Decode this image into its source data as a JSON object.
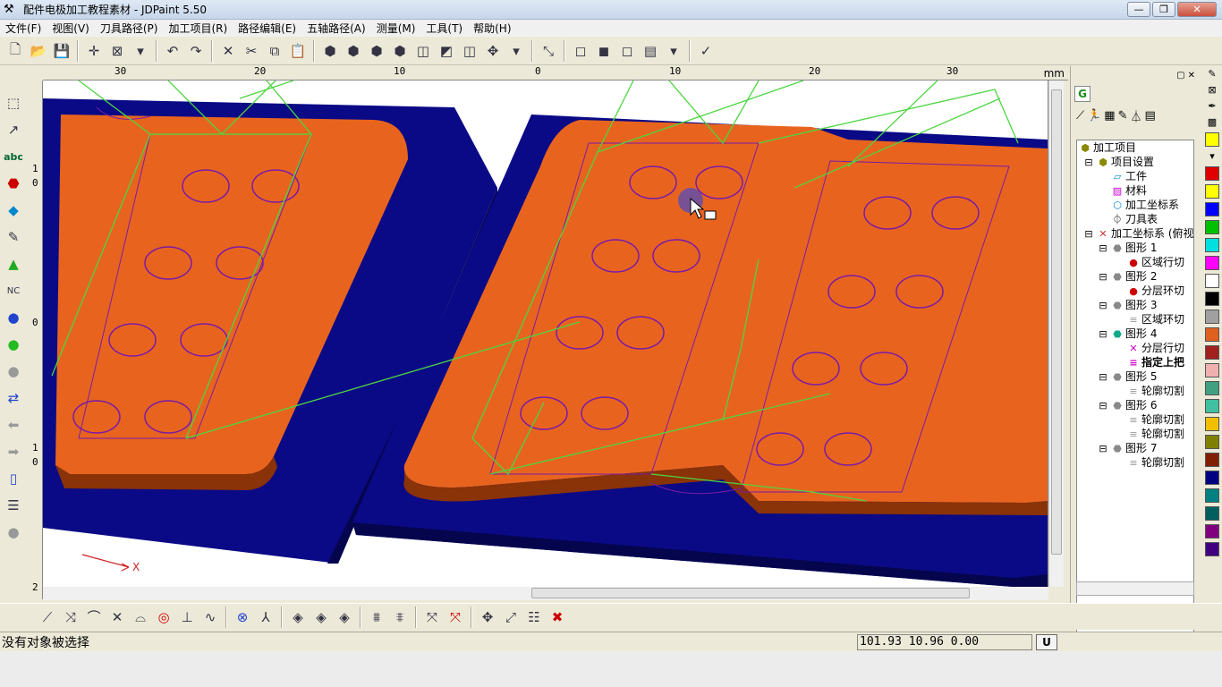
{
  "window": {
    "title": "配件电极加工教程素材 - JDPaint 5.50"
  },
  "menu": [
    "文件(F)",
    "视图(V)",
    "刀具路径(P)",
    "加工项目(R)",
    "路径编辑(E)",
    "五轴路径(A)",
    "测量(M)",
    "工具(T)",
    "帮助(H)"
  ],
  "ruler": {
    "ticks": [
      "30",
      "20",
      "10",
      "0",
      "10",
      "20",
      "30"
    ],
    "unit": "mm"
  },
  "vruler": {
    "ticks": [
      "1",
      "0",
      "0",
      "1",
      "0",
      "2"
    ]
  },
  "axis_label": "X",
  "tree": {
    "root": "加工项目",
    "settings": "项目设置",
    "workpiece": "工件",
    "material": "材料",
    "coord": "加工坐标系",
    "toollist": "刀具表",
    "coord2": "加工坐标系 (俯视",
    "g1": "图形 1",
    "g1a": "区域行切",
    "g2": "图形 2",
    "g2a": "分层环切",
    "g3": "图形 3",
    "g3a": "区域环切",
    "g4": "图形 4",
    "g4a": "分层行切",
    "g4b": "指定上把",
    "g5": "图形 5",
    "g5a": "轮廓切割",
    "g6": "图形 6",
    "g6a": "轮廓切割",
    "g6b": "轮廓切割",
    "g7": "图形 7",
    "g7a": "轮廓切割"
  },
  "palette_colors": [
    "#ffff00",
    "#e00000",
    "#ffff00",
    "#0000ff",
    "#00c000",
    "#00e0e0",
    "#ff00ff",
    "#ffffff",
    "#000000",
    "#a0a0a0",
    "#e06020",
    "#a02020",
    "#f0b0b0",
    "#40a080",
    "#40c0a0",
    "#f0c000",
    "#808000",
    "#802000",
    "#000080",
    "#008080",
    "#006060",
    "#800080",
    "#400080"
  ],
  "status": {
    "message": "没有对象被选择",
    "coords": "101.93 10.96 0.00",
    "unit_button": "U"
  },
  "colors": {
    "base": "#0a0a86",
    "part": "#e8641e",
    "path_green": "#4cd640",
    "path_purple": "#7a1aa8"
  }
}
